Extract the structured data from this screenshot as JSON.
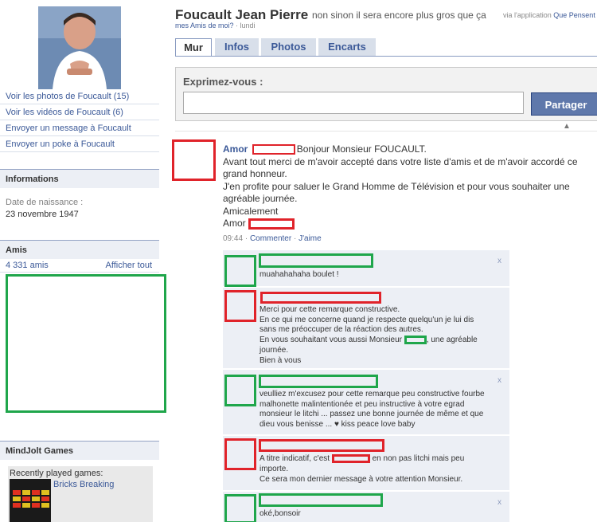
{
  "profile": {
    "name": "Foucault Jean Pierre",
    "status": "non sinon il sera encore plus gros que ça",
    "via_prefix": "via l'application",
    "via_app_name": "Que Pensent",
    "via_app_line2": "mes Amis de moi?",
    "timestamp": "· lundi"
  },
  "left_links": [
    "Voir les photos de Foucault (15)",
    "Voir les vidéos de Foucault (6)",
    "Envoyer un message à Foucault",
    "Envoyer un poke à Foucault"
  ],
  "info": {
    "header": "Informations",
    "label": "Date de naissance :",
    "value": "23 novembre 1947"
  },
  "friends": {
    "header": "Amis",
    "count": "4 331 amis",
    "see_all": "Afficher tout"
  },
  "games": {
    "header": "MindJolt Games",
    "label": "Recently played games:",
    "game": "Bricks Breaking"
  },
  "tabs": [
    "Mur",
    "Infos",
    "Photos",
    "Encarts"
  ],
  "publisher": {
    "label": "Exprimez-vous :",
    "placeholder": "",
    "button": "Partager"
  },
  "post": {
    "author": "Amor",
    "greeting": "Bonjour Monsieur FOUCAULT.",
    "body1": "Avant tout merci de m'avoir accepté dans votre liste d'amis et de m'avoir accordé ce grand honneur.",
    "body2": "J'en profite pour saluer le Grand Homme de Télévision et pour vous souhaiter une agréable journée.",
    "sign1": "Amicalement",
    "sign2": "Amor",
    "time": "09:44",
    "sep": "·",
    "comment_link": "Commenter",
    "like_link": "J'aime"
  },
  "comments": [
    {
      "text": "muahahahaha boulet !",
      "close": "x"
    },
    {
      "line1": "Merci pour cette remarque constructive.",
      "line2": "En ce qui me concerne quand je respecte quelqu'un je lui dis sans me préoccuper de la réaction des autres.",
      "line3_pre": "En vous souhaitant vous aussi Monsieur",
      "line3_post": ", une agréable journée.",
      "line4": "Bien à vous"
    },
    {
      "text": "veulliez m'excusez pour cette remarque peu constructive fourbe malhonette malintentionée et peu instructive à votre egrad monsieur le litchi ... passez une bonne journée de même et que dieu vous benisse ... ♥ kiss peace love baby",
      "close": "x"
    },
    {
      "line1_pre": "A titre indicatif, c'est",
      "line1_post": "en non pas litchi mais peu importe.",
      "line2": "Ce sera mon dernier message à votre attention Monsieur."
    },
    {
      "text": "oké,bonsoir",
      "close": "x"
    }
  ],
  "colors": {
    "facebook_blue": "#3b5998",
    "redaction_red": "#e0232a",
    "redaction_green": "#1fa64b",
    "comment_bg": "#eceff5"
  }
}
